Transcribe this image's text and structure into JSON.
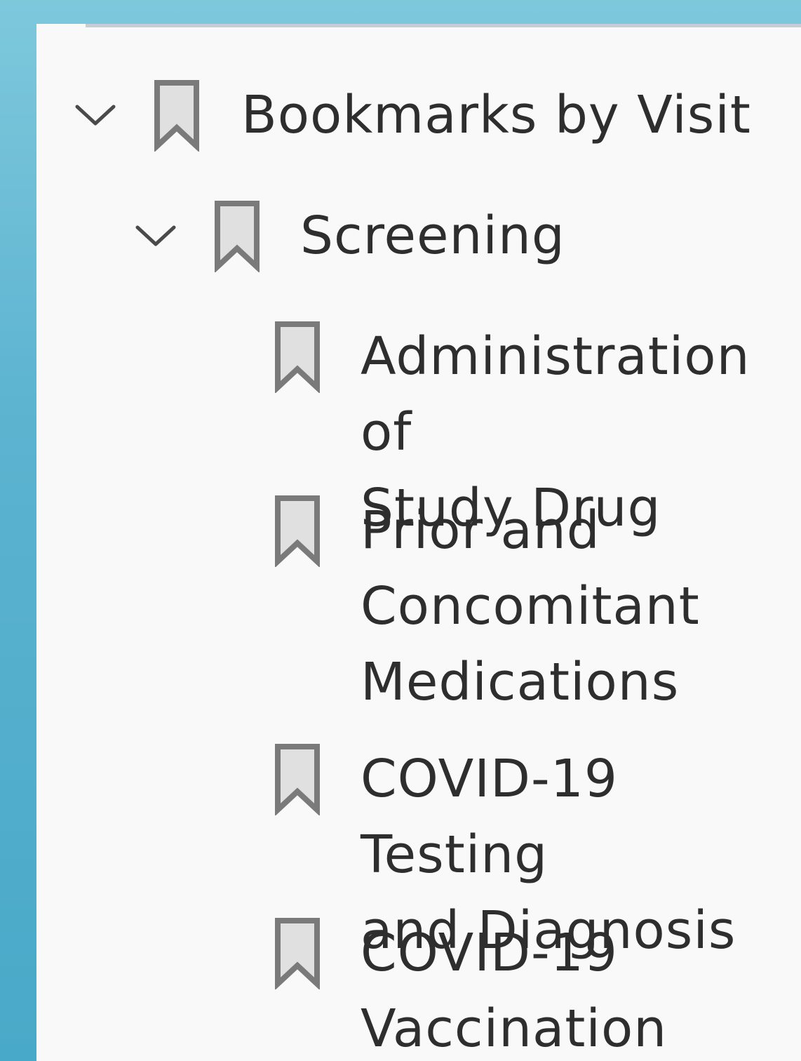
{
  "bookmarks_tree": {
    "root": {
      "label": "Bookmarks by Visit",
      "expanded": true,
      "icon": "bookmark-icon",
      "children": [
        {
          "label": "Screening",
          "expanded": true,
          "icon": "bookmark-icon",
          "children": [
            {
              "label": "Administration of\nStudy Drug",
              "icon": "bookmark-icon"
            },
            {
              "label": "Prior and\nConcomitant\nMedications",
              "icon": "bookmark-icon"
            },
            {
              "label": "COVID-19 Testing\nand Diagnosis",
              "icon": "bookmark-icon"
            },
            {
              "label": "COVID-19\nVaccination",
              "icon": "bookmark-icon"
            }
          ]
        }
      ]
    }
  },
  "colors": {
    "background_top": "#7ec8dc",
    "background_bottom": "#49a9c8",
    "panel": "#f9f9f9",
    "text": "#2e2e2e",
    "icon_stroke": "#7a7a7a",
    "icon_fill": "#e0e0e0"
  }
}
